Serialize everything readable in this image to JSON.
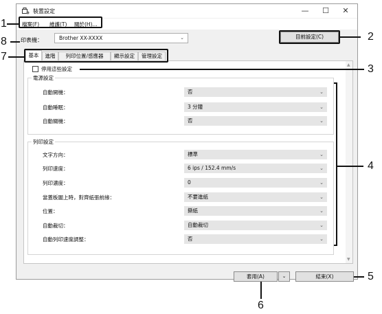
{
  "window": {
    "title": "裝置設定",
    "controls": {
      "minimize": "—",
      "maximize": "☐",
      "close": "✕"
    }
  },
  "menu": [
    "檔案(F)",
    "維護(T)",
    "關於(H)..."
  ],
  "printer": {
    "label": "印表機：",
    "value": "Brother   XX-XXXX",
    "current_settings_button": "目前設定(C)"
  },
  "tabs": [
    {
      "label": "基本",
      "active": true
    },
    {
      "label": "進階"
    },
    {
      "label": "列印位置/感應器"
    },
    {
      "label": "顯示設定"
    },
    {
      "label": "管理設定"
    }
  ],
  "disable_settings": {
    "label": "停用這些設定",
    "checked": false
  },
  "power_settings": {
    "title": "電源設定",
    "rows": [
      {
        "label": "自動開機：",
        "value": "否"
      },
      {
        "label": "自動睡眠：",
        "value": "3 分鐘"
      },
      {
        "label": "自動關機：",
        "value": "否"
      }
    ]
  },
  "print_settings": {
    "title": "列印設定",
    "rows": [
      {
        "label": "文字方向：",
        "value": "標準"
      },
      {
        "label": "列印速度：",
        "value": "6 ips / 152.4 mm/s"
      },
      {
        "label": "列印濃度：",
        "value": "0"
      },
      {
        "label": "當蓋板闔上時，對齊紙張前緣：",
        "value": "不要進紙"
      },
      {
        "label": "位置：",
        "value": "撕紙"
      },
      {
        "label": "自動裁切：",
        "value": "自動裁切"
      },
      {
        "label": "自動列印速度調整：",
        "value": "否"
      }
    ]
  },
  "buttons": {
    "apply": "套用(A)",
    "apply_dropdown": "⌄",
    "exit": "結束(X)"
  },
  "callouts": [
    "1",
    "2",
    "3",
    "4",
    "5",
    "6",
    "7",
    "8"
  ]
}
